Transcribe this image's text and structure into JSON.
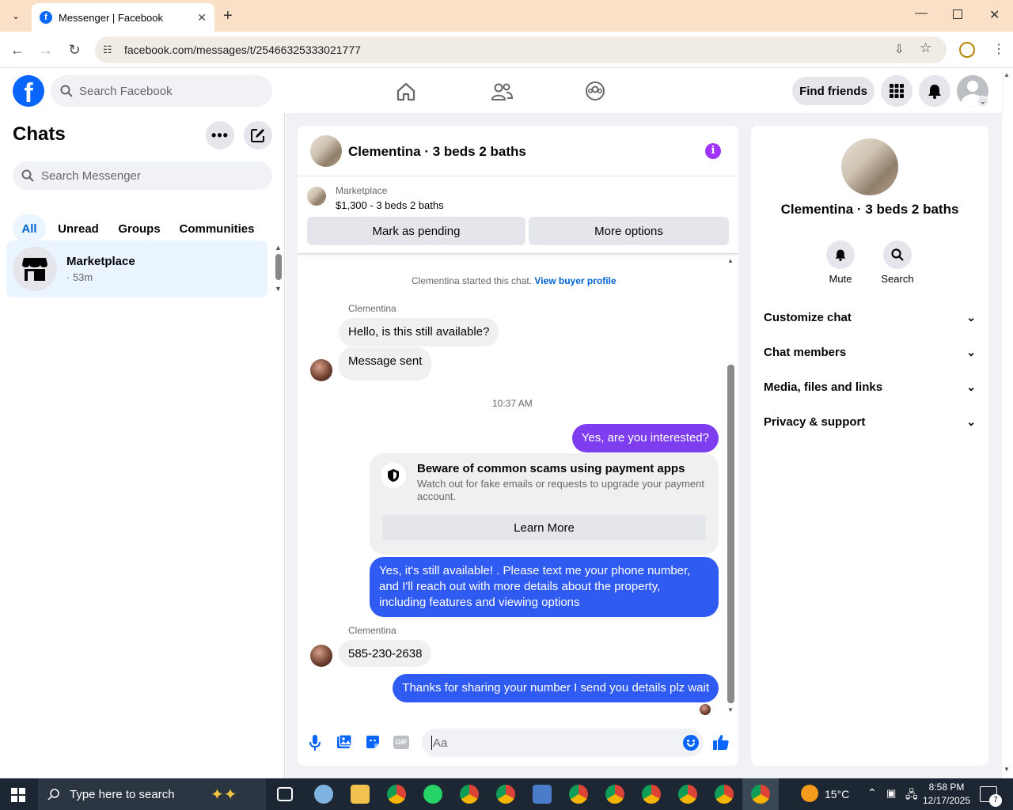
{
  "browser": {
    "tab_title": "Messenger | Facebook",
    "url": "facebook.com/messages/t/25466325333021777"
  },
  "fb": {
    "search_placeholder": "Search Facebook",
    "find_friends": "Find friends"
  },
  "chats": {
    "title": "Chats",
    "search_placeholder": "Search Messenger",
    "filters": [
      "All",
      "Unread",
      "Groups",
      "Communities"
    ],
    "items": [
      {
        "name": "Marketplace",
        "time": "· 53m"
      }
    ]
  },
  "conversation": {
    "title": "Clementina · 3 beds 2 baths",
    "listing": {
      "source": "Marketplace",
      "summary": "$1,300 - 3 beds 2 baths",
      "mark_pending": "Mark as pending",
      "more_options": "More options"
    },
    "started_text": "Clementina started this chat.",
    "view_profile": "View buyer profile",
    "sender_name": "Clementina",
    "messages": {
      "m1": "Hello, is this still available?",
      "m2": "Message sent",
      "timestamp": "10:37 AM",
      "m3": "Yes, are you interested?",
      "m4": "Yes, it's still available! . Please text me your phone number, and I'll reach out with more details about the property, including features and viewing options",
      "sender2": "Clementina",
      "m5": "585-230-2638",
      "m6": "Thanks for sharing your number I send you details plz wait"
    },
    "scam_card": {
      "title": "Beware of common scams using payment apps",
      "body": "Watch out for fake emails or requests to upgrade your payment account.",
      "button": "Learn More"
    },
    "composer_placeholder": "Aa"
  },
  "info_panel": {
    "title": "Clementina · 3 beds 2 baths",
    "mute": "Mute",
    "search": "Search",
    "sections": [
      "Customize chat",
      "Chat members",
      "Media, files and links",
      "Privacy & support"
    ]
  },
  "taskbar": {
    "search_placeholder": "Type here to search",
    "temperature": "15°C",
    "time": "8:58 PM",
    "date": "12/17/2025",
    "notif_count": "7"
  },
  "colors": {
    "fb_blue": "#0866ff",
    "messenger_purple": "#a033ff",
    "outgoing_blue": "#0a7cff"
  }
}
